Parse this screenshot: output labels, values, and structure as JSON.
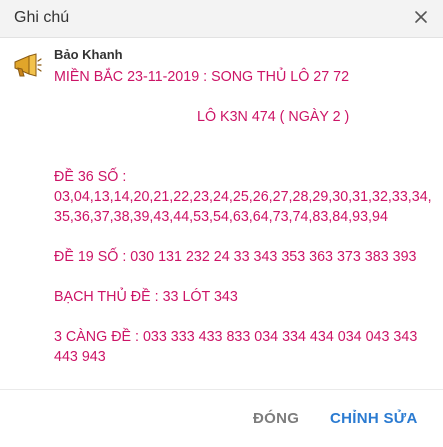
{
  "dialog": {
    "title": "Ghi chú"
  },
  "note": {
    "author": "Bảo Khanh",
    "lines": [
      "MIỀN BẮC 23-11-2019 : SONG THỦ LÔ 27 72",
      "",
      "                                    LÔ K3N 474 ( NGÀY 2 )",
      "",
      "",
      "ĐỀ 36 SỐ :",
      "03,04,13,14,20,21,22,23,24,25,26,27,28,29,30,31,32,33,34,",
      "35,36,37,38,39,43,44,53,54,63,64,73,74,83,84,93,94",
      "",
      "ĐỀ 19 SỐ : 030 131 232 24 33 343 353 363 373 383 393",
      "",
      "BẠCH THỦ ĐỀ : 33 LÓT 343",
      "",
      "3 CÀNG ĐỀ : 033 333 433 833 034 334 434 034 043 343",
      "443 943"
    ]
  },
  "footer": {
    "close_label": "ĐÓNG",
    "edit_label": "CHỈNH SỬA"
  },
  "icons": {
    "close": "close-icon",
    "avatar": "megaphone-icon"
  },
  "colors": {
    "note_text": "#cc1466",
    "edit_button": "#2b7bd1",
    "close_button": "#7d7d7d"
  }
}
